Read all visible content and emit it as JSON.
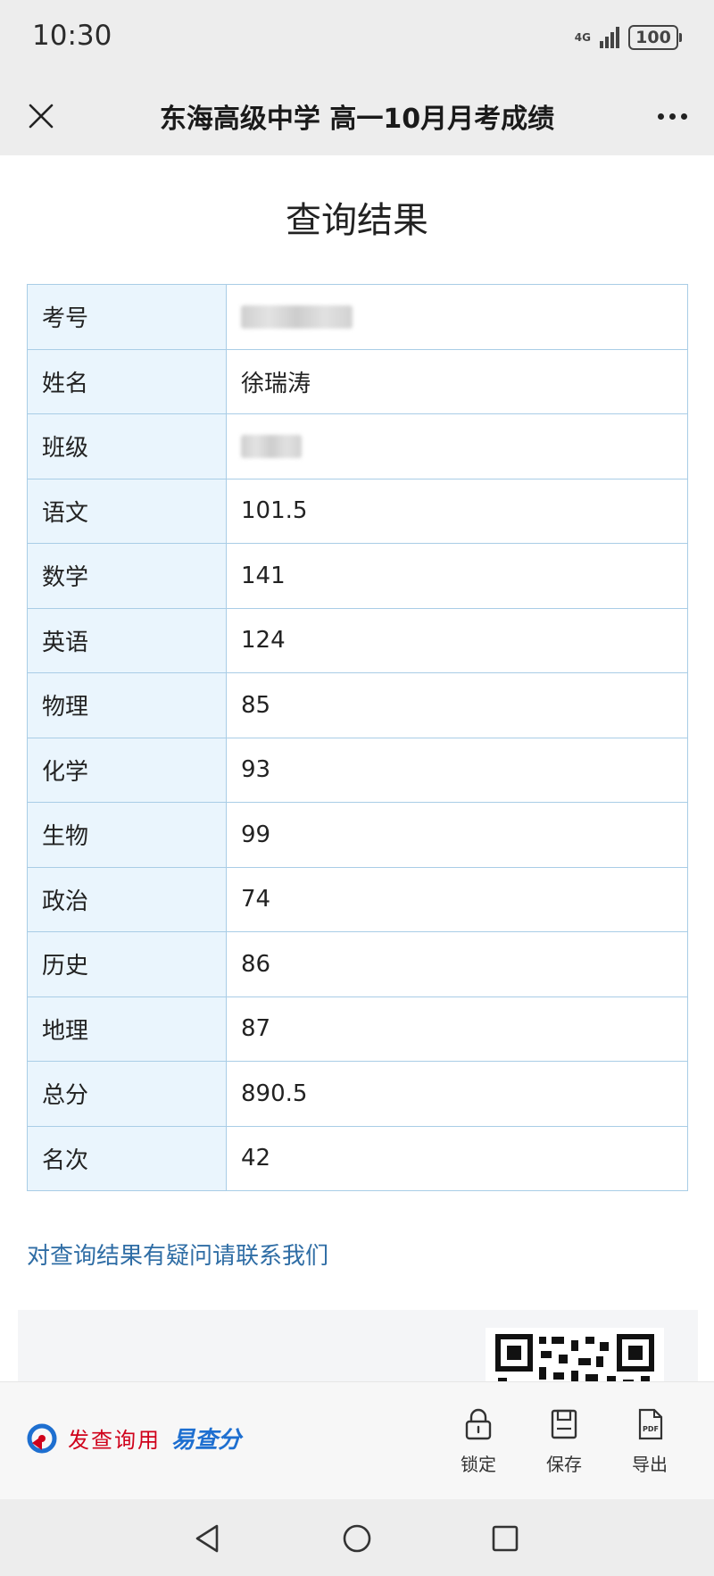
{
  "status_bar": {
    "time": "10:30",
    "network": "4G",
    "battery": "100"
  },
  "nav": {
    "title": "东海高级中学 高一10月月考成绩"
  },
  "result": {
    "title": "查询结果",
    "rows": [
      {
        "label": "考号",
        "value": "",
        "blurred": true
      },
      {
        "label": "姓名",
        "value": "徐瑞涛"
      },
      {
        "label": "班级",
        "value": "",
        "blurred": true
      },
      {
        "label": "语文",
        "value": "101.5"
      },
      {
        "label": "数学",
        "value": "141"
      },
      {
        "label": "英语",
        "value": "124"
      },
      {
        "label": "物理",
        "value": "85"
      },
      {
        "label": "化学",
        "value": "93"
      },
      {
        "label": "生物",
        "value": "99"
      },
      {
        "label": "政治",
        "value": "74"
      },
      {
        "label": "历史",
        "value": "86"
      },
      {
        "label": "地理",
        "value": "87"
      },
      {
        "label": "总分",
        "value": "890.5"
      },
      {
        "label": "名次",
        "value": "42"
      }
    ],
    "contact_link": "对查询结果有疑问请联系我们"
  },
  "toolbar": {
    "brand_prefix": "发查询用",
    "brand_name": "易查分",
    "lock_label": "锁定",
    "save_label": "保存",
    "export_label": "导出",
    "pdf_icon_text": "PDF"
  },
  "colors": {
    "label_bg": "#eaf5fd",
    "border": "#a9cde6",
    "link": "#2f6da5",
    "brand_red": "#d0021b",
    "brand_blue": "#1e6fd0"
  }
}
